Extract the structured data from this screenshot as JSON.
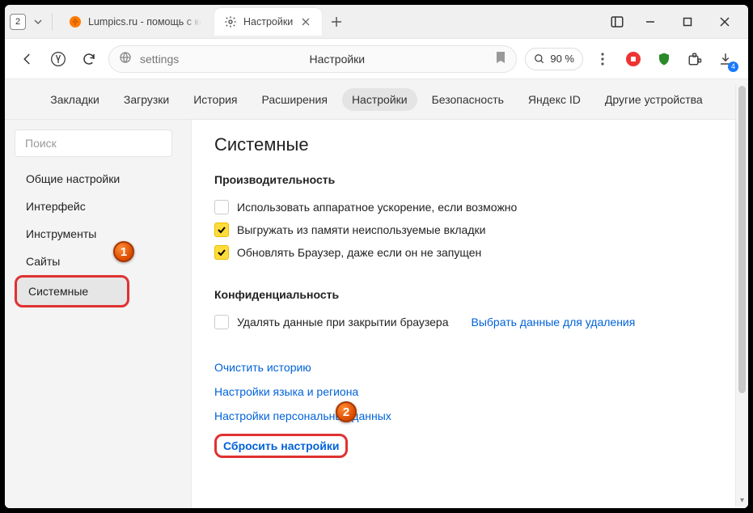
{
  "tabs": {
    "count": "2",
    "inactive_title": "Lumpics.ru - помощь с ком",
    "active_title": "Настройки"
  },
  "window_controls": {
    "min": "—",
    "max": "▢",
    "close": "✕"
  },
  "toolbar": {
    "url_path": "settings",
    "page_title": "Настройки",
    "zoom": "90 %",
    "dl_count": "4"
  },
  "settings_nav": {
    "items": [
      "Закладки",
      "Загрузки",
      "История",
      "Расширения",
      "Настройки",
      "Безопасность",
      "Яндекс ID",
      "Другие устройства"
    ],
    "active_index": 4
  },
  "sidebar": {
    "search_placeholder": "Поиск",
    "items": [
      "Общие настройки",
      "Интерфейс",
      "Инструменты",
      "Сайты",
      "Системные"
    ],
    "active_index": 4
  },
  "content": {
    "heading": "Системные",
    "group_performance": "Производительность",
    "perf_items": [
      {
        "label": "Использовать аппаратное ускорение, если возможно",
        "checked": false
      },
      {
        "label": "Выгружать из памяти неиспользуемые вкладки",
        "checked": true
      },
      {
        "label": "Обновлять Браузер, даже если он не запущен",
        "checked": true
      }
    ],
    "group_privacy": "Конфиденциальность",
    "privacy_item": {
      "label": "Удалять данные при закрытии браузера",
      "checked": false
    },
    "privacy_link": "Выбрать данные для удаления",
    "links": {
      "clear_history": "Очистить историю",
      "lang_region": "Настройки языка и региона",
      "personal_data": "Настройки персональных данных",
      "reset_settings": "Сбросить настройки"
    }
  },
  "markers": {
    "one": "1",
    "two": "2"
  }
}
